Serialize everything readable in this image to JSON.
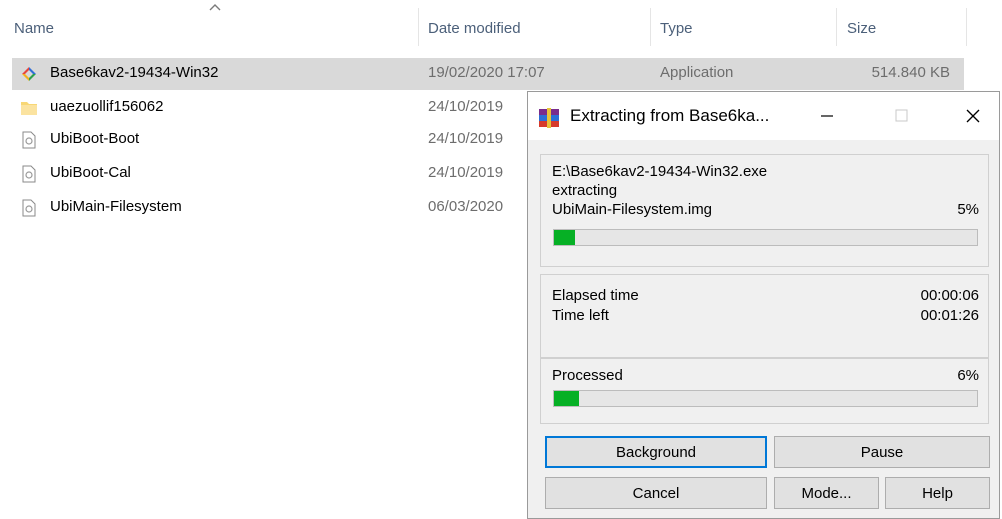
{
  "columns": {
    "name": "Name",
    "date_modified": "Date modified",
    "type": "Type",
    "size": "Size"
  },
  "files": [
    {
      "name": "Base6kav2-19434-Win32",
      "date": "19/02/2020 17:07",
      "type": "Application",
      "size": "514.840 KB",
      "icon": "application-icon",
      "selected": true
    },
    {
      "name": "uaezuollif156062",
      "date": "24/10/2019",
      "type": "",
      "size": "",
      "icon": "folder-icon",
      "selected": false
    },
    {
      "name": "UbiBoot-Boot",
      "date": "24/10/2019",
      "type": "",
      "size": "",
      "icon": "file-icon",
      "selected": false
    },
    {
      "name": "UbiBoot-Cal",
      "date": "24/10/2019",
      "type": "",
      "size": "",
      "icon": "file-icon",
      "selected": false
    },
    {
      "name": "UbiMain-Filesystem",
      "date": "06/03/2020",
      "type": "",
      "size": "",
      "icon": "file-icon",
      "selected": false
    }
  ],
  "dialog": {
    "title": "Extracting from Base6ka...",
    "archive_path": "E:\\Base6kav2-19434-Win32.exe",
    "action": "extracting",
    "current_file": "UbiMain-Filesystem.img",
    "file_percent": "5%",
    "file_progress": 0.05,
    "elapsed_label": "Elapsed time",
    "elapsed_value": "00:00:06",
    "left_label": "Time left",
    "left_value": "00:01:26",
    "processed_label": "Processed",
    "processed_percent": "6%",
    "processed_progress": 0.06,
    "buttons": {
      "background": "Background",
      "pause": "Pause",
      "cancel": "Cancel",
      "mode": "Mode...",
      "help": "Help"
    },
    "colors": {
      "progress_fill": "#06b025",
      "default_button_border": "#0078d7"
    }
  }
}
